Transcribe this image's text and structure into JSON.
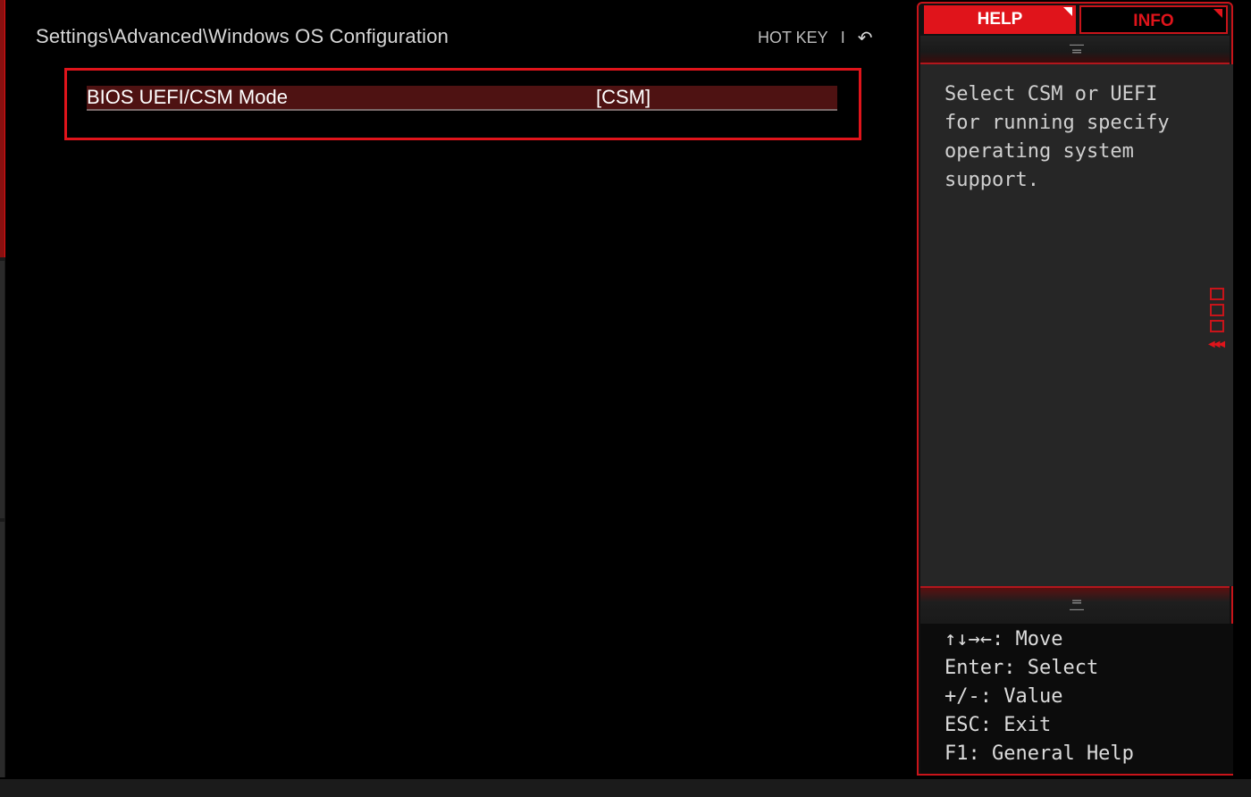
{
  "breadcrumb": "Settings\\Advanced\\Windows OS Configuration",
  "hotkey": {
    "label": "HOT KEY",
    "separator": "I",
    "back_glyph": "↶",
    "back_icon": "undo-arrow-icon"
  },
  "option": {
    "label": "BIOS UEFI/CSM Mode",
    "value": "[CSM]"
  },
  "tabs": {
    "help": "HELP",
    "info": "INFO"
  },
  "help": {
    "text": "Select CSM or UEFI\nfor running specify\noperating system\nsupport."
  },
  "keys": [
    {
      "text": "↑↓→←: Move"
    },
    {
      "text": "Enter: Select"
    },
    {
      "text": "+/-: Value"
    },
    {
      "text": "ESC: Exit"
    },
    {
      "text": "F1: General Help"
    }
  ],
  "colors": {
    "accent": "#e0141b",
    "selected_row": "#4e1212",
    "background": "#000000",
    "help_bg": "#262626"
  },
  "icons": {
    "scroll_up": "grip-up-icon",
    "scroll_down": "grip-down-icon",
    "side_handle": "panel-toggle-icon"
  }
}
